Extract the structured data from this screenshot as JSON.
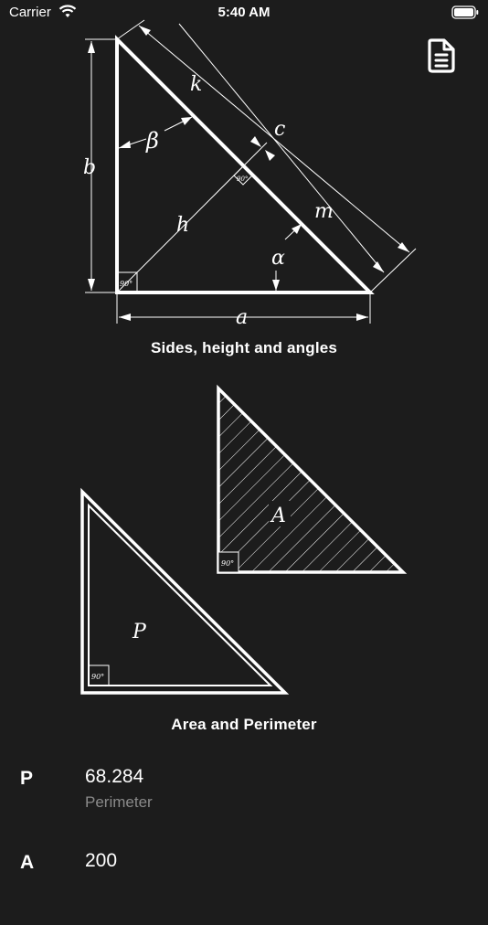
{
  "status_bar": {
    "carrier": "Carrier",
    "time": "5:40 AM"
  },
  "toolbar": {
    "document_icon": "document-icon"
  },
  "diagrams": {
    "sides": {
      "caption": "Sides, height and angles",
      "labels": {
        "k": "k",
        "c": "c",
        "beta": "β",
        "b": "b",
        "h": "h",
        "m": "m",
        "alpha": "α",
        "a": "a",
        "right_angle": "90°"
      }
    },
    "area_perimeter": {
      "caption": "Area and Perimeter",
      "labels": {
        "area": "A",
        "perimeter": "P",
        "right_angle": "90°"
      }
    }
  },
  "results": [
    {
      "symbol": "P",
      "value": "68.284",
      "label": "Perimeter"
    },
    {
      "symbol": "A",
      "value": "200",
      "label": ""
    }
  ]
}
